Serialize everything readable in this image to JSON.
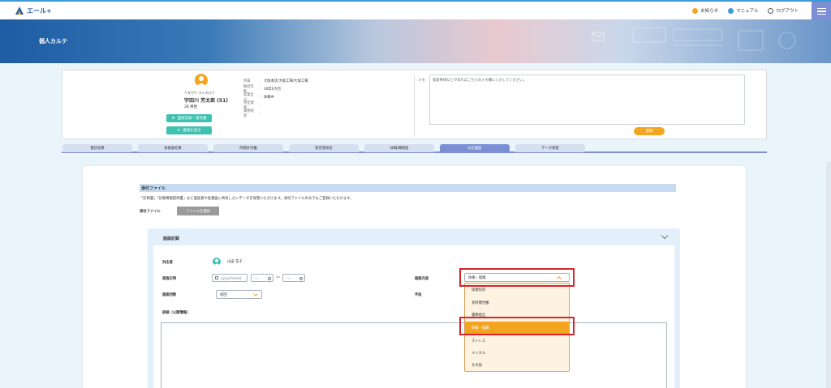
{
  "app": {
    "logo_text": "エール+"
  },
  "header": {
    "links": [
      {
        "label": "お知らせ",
        "icon": "bell-icon",
        "color": "#f4a51f"
      },
      {
        "label": "マニュアル",
        "icon": "help-icon",
        "color": "#3a9bd5"
      },
      {
        "label": "ログアウト",
        "icon": "power-icon",
        "color": "#555555"
      }
    ]
  },
  "hero": {
    "title": "個人カルテ"
  },
  "profile": {
    "kana": "ウダガワ ヨシタロウ",
    "name": "宇田川 芳太郎 (51)",
    "age_sex": "28 男性",
    "btn_mental": "面接記録・意見書",
    "btn_contact": "連絡を送る",
    "info": [
      {
        "label": "所属",
        "value": "大阪本店/大阪工場/大阪工場"
      },
      {
        "label": "勤続年数",
        "value": "30年0カ月"
      },
      {
        "label": "就業区分",
        "value": "休職中"
      },
      {
        "label": "特定業務",
        "value": ""
      },
      {
        "label": "業務経歴",
        "value": ""
      }
    ],
    "memo_label": "メモ：",
    "memo_text": "留意事項などがあればこちらのメモ欄に入力してください。",
    "save_label": "登録"
  },
  "tabs": [
    {
      "label": "健診結果",
      "active": false
    },
    {
      "label": "再検査結果",
      "active": false
    },
    {
      "label": "時間外労働",
      "active": false
    },
    {
      "label": "新型感染症",
      "active": false
    },
    {
      "label": "休職/職務歴",
      "active": false
    },
    {
      "label": "対応履歴",
      "active": true
    },
    {
      "label": "データ保管",
      "active": false
    }
  ],
  "attach": {
    "section_title": "添付ファイル",
    "description": "「診断書」「診療情報提供書」など面談者や産業医に共有したいデータを保管いただけます。添付ファイルのみでもご登録いただけます。",
    "label": "添付ファイル",
    "button": "ファイルを選択"
  },
  "record": {
    "title": "面談記録",
    "responder_label": "対応者",
    "responder_name": "山田 花子",
    "date_label": "実施日時",
    "date_placeholder": "yyyy/mm/dd",
    "time_placeholder": "--:--",
    "tilde": "～",
    "count_label": "面談回数",
    "count_value": "初回",
    "content_label": "面談内容",
    "content_value": "休職・復職",
    "method_label": "手段",
    "detail_label": "詳細（公開情報）"
  },
  "dropdown_options": [
    "保健指導",
    "長時間労働",
    "書類提出",
    "休職・復職",
    "ストレス",
    "メンタル",
    "その他"
  ],
  "dropdown_selected": "休職・復職",
  "colors": {
    "accent": "#f4a51f",
    "teal": "#3fc1b1",
    "tab_active": "#7c8fd4",
    "highlight": "#d9232d"
  }
}
